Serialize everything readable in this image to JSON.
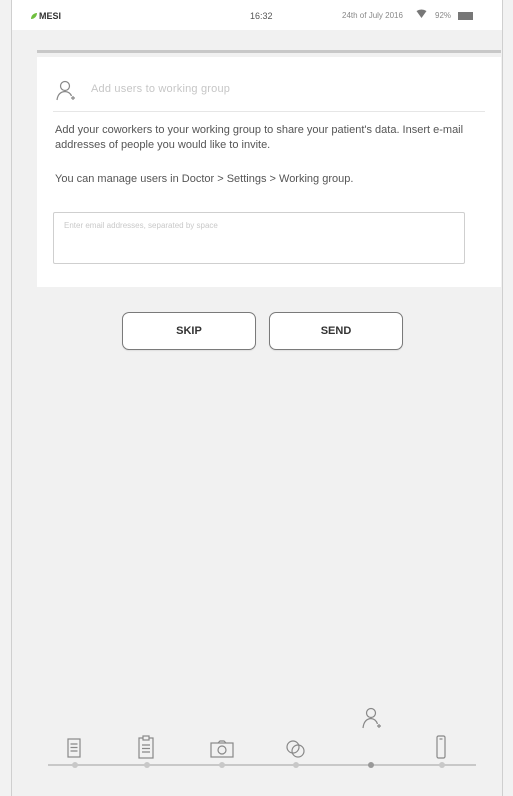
{
  "status_bar": {
    "app_name": "MESI",
    "time": "16:32",
    "date": "24th of July 2016",
    "battery": "92%"
  },
  "card": {
    "title_placeholder": "Add users to working group",
    "description": "Add your coworkers to your working group to share your patient's data. Insert e-mail addresses of people you would like to invite.",
    "manage_hint": "You can manage users in Doctor > Settings > Working group.",
    "email_placeholder": "Enter email addresses, separated by space"
  },
  "buttons": {
    "skip": "SKIP",
    "send": "SEND"
  },
  "bottom_nav": {
    "steps": [
      "document-icon",
      "clipboard-icon",
      "camera-icon",
      "link-icon",
      "add-user-icon",
      "device-icon"
    ],
    "active_step": "add-user-icon"
  },
  "colors": {
    "brand_green": "#6fbf3e",
    "background": "#f1f1f1",
    "card": "#ffffff"
  }
}
